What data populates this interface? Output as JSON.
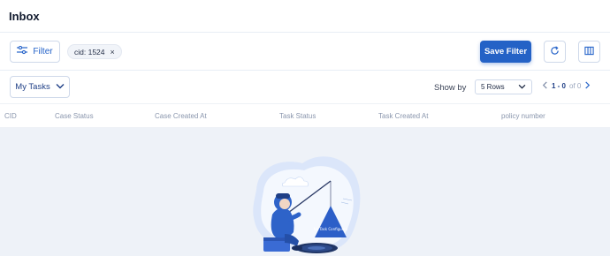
{
  "header": {
    "title": "Inbox"
  },
  "toolbar": {
    "filter_label": "Filter",
    "filter_chip": "cid: 1524",
    "chip_remove": "×",
    "save_filter_label": "Save Filter",
    "refresh_icon": "refresh-icon",
    "columns_icon": "columns-icon"
  },
  "subbar": {
    "view_label": "My Tasks",
    "show_by_label": "Show by",
    "rows_value": "5 Rows",
    "pager_range": "1 - 0",
    "pager_of": "of 0"
  },
  "table": {
    "columns": [
      "CID",
      "Case Status",
      "Case Created At",
      "Task Status",
      "Task Created At",
      "policy number"
    ],
    "rows": []
  },
  "empty_state": {
    "sign_text": "No Task Configured"
  },
  "colors": {
    "primary": "#2462c6",
    "body_bg": "#eef2f8",
    "header_text": "#8a96ad"
  }
}
